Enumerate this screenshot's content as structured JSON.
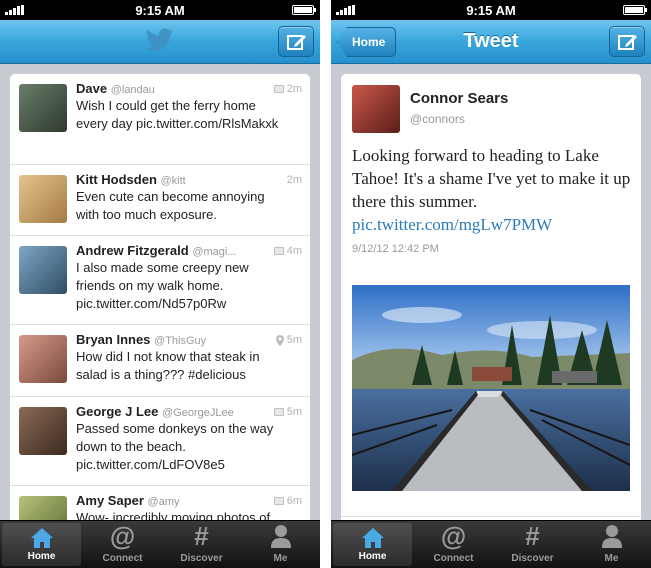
{
  "status": {
    "time": "9:15 AM"
  },
  "timeline": {
    "tweets": [
      {
        "name": "Dave",
        "handle": "@landau",
        "time": "2m",
        "text": "Wish I could get the ferry home every day pic.twitter.com/RlsMakxk",
        "meta_icon": "image-icon",
        "avatar_color": "#3a4b3a"
      },
      {
        "name": "Kitt Hodsden",
        "handle": "@kitt",
        "time": "2m",
        "text": "Even cute can become annoying with too much exposure.",
        "meta_icon": "",
        "avatar_color": "#c9a56a"
      },
      {
        "name": "Andrew Fitzgerald",
        "handle": "@magi...",
        "time": "4m",
        "text": "I also made some creepy new friends on my walk home. pic.twitter.com/Nd57p0Rw",
        "meta_icon": "image-icon",
        "avatar_color": "#4a6f8a"
      },
      {
        "name": "Bryan Innes",
        "handle": "@ThisGuy",
        "time": "5m",
        "text": "How did I not know that steak in salad is a thing??? #delicious",
        "meta_icon": "location-pin-icon",
        "avatar_color": "#b77a6a"
      },
      {
        "name": "George J Lee",
        "handle": "@GeorgeJLee",
        "time": "5m",
        "text": "Passed some donkeys on the way down to the beach. pic.twitter.com/LdFOV8e5",
        "meta_icon": "image-icon",
        "avatar_color": "#6b4d3d"
      },
      {
        "name": "Amy Saper",
        "handle": "@amy",
        "time": "6m",
        "text": "Wow- incredibly moving photos of",
        "meta_icon": "image-icon",
        "avatar_color": "#8d9a5a"
      }
    ]
  },
  "tabs": [
    {
      "label": "Home",
      "icon": "house-icon"
    },
    {
      "label": "Connect",
      "icon": "at-sign-icon"
    },
    {
      "label": "Discover",
      "icon": "hashtag-icon"
    },
    {
      "label": "Me",
      "icon": "person-icon"
    }
  ],
  "tab_glyphs": {
    "connect": "@",
    "discover": "#"
  },
  "detail": {
    "back_label": "Home",
    "title": "Tweet",
    "name": "Connor Sears",
    "handle": "@connors",
    "text": "Looking forward to heading to Lake Tahoe! It's a shame I've yet to make it up there this summer.",
    "link": "pic.twitter.com/mgLw7PMW",
    "timestamp": "9/12/12 12:42 PM"
  },
  "colors": {
    "nav_blue": "#38a6dc",
    "link": "#2b7bb9",
    "tabbar": "#1e1e1e"
  }
}
